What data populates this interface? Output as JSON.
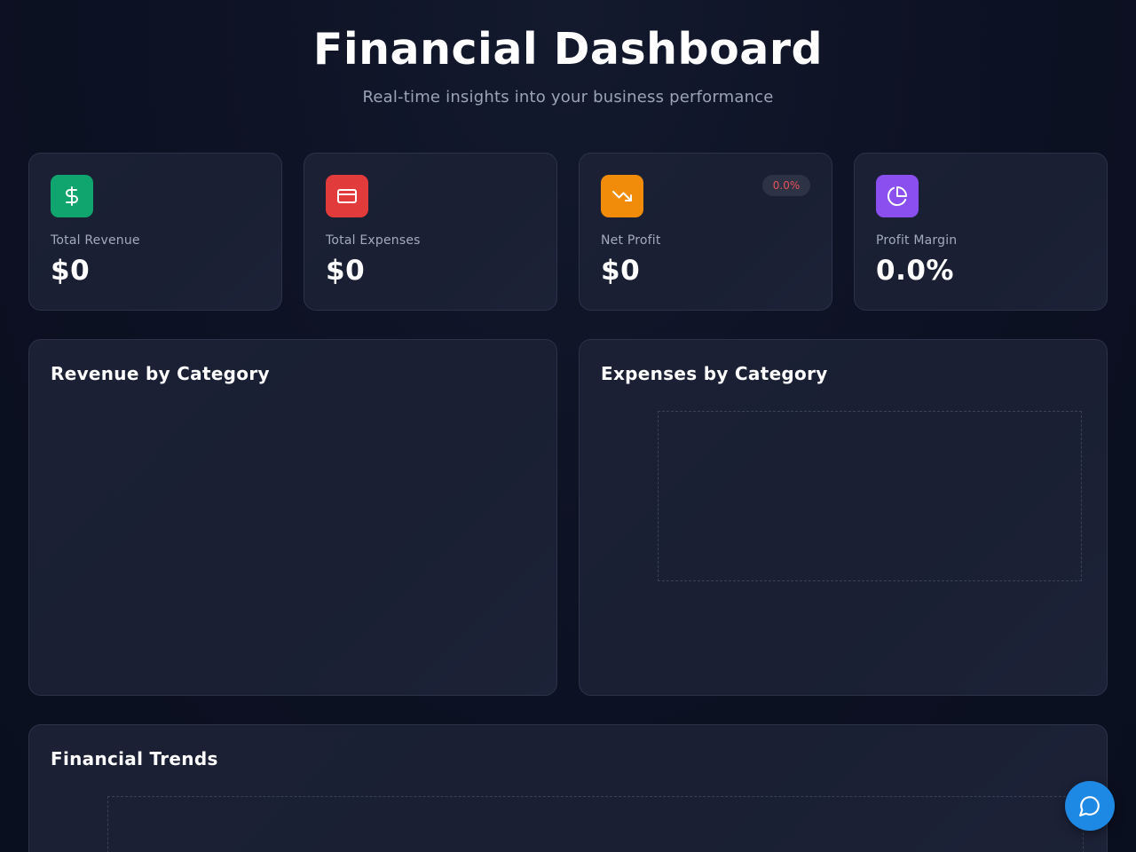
{
  "header": {
    "title": "Financial Dashboard",
    "subtitle": "Real-time insights into your business performance"
  },
  "stats": [
    {
      "label": "Total Revenue",
      "value": "$0",
      "icon": "dollar-icon",
      "color": "#10a56f"
    },
    {
      "label": "Total Expenses",
      "value": "$0",
      "icon": "credit-card-icon",
      "color": "#e23b3b"
    },
    {
      "label": "Net Profit",
      "value": "$0",
      "icon": "trending-down-icon",
      "color": "#f08c0a",
      "change": "0.0%",
      "change_color": "#e8525a"
    },
    {
      "label": "Profit Margin",
      "value": "0.0%",
      "icon": "pie-chart-icon",
      "color": "#8b4ff0"
    }
  ],
  "charts": {
    "revenue_by_category": {
      "title": "Revenue by Category"
    },
    "expenses_by_category": {
      "title": "Expenses by Category"
    },
    "financial_trends": {
      "title": "Financial Trends"
    }
  },
  "chat_button": {
    "icon": "chat-bubble-icon",
    "color": "#1e88e5"
  }
}
